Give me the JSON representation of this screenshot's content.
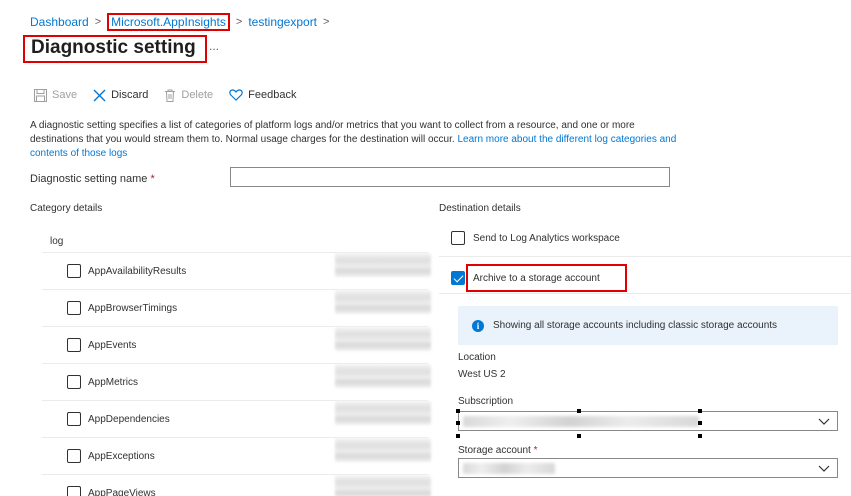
{
  "breadcrumb": {
    "items": [
      "Dashboard",
      "Microsoft.AppInsights",
      "testingexport"
    ],
    "separator": ">"
  },
  "header": {
    "title": "Diagnostic setting",
    "more": "..."
  },
  "toolbar": {
    "save_label": "Save",
    "discard_label": "Discard",
    "delete_label": "Delete",
    "feedback_label": "Feedback"
  },
  "description": {
    "text": "A diagnostic setting specifies a list of categories of platform logs and/or metrics that you want to collect from a resource, and one or more destinations that you would stream them to. Normal usage charges for the destination will occur.",
    "link": "Learn more about the different log categories and contents of those logs"
  },
  "name_field": {
    "label": "Diagnostic setting name",
    "required_mark": "*",
    "value": ""
  },
  "category_details": {
    "header": "Category details",
    "group_label": "log",
    "items": [
      {
        "label": "AppAvailabilityResults",
        "checked": false
      },
      {
        "label": "AppBrowserTimings",
        "checked": false
      },
      {
        "label": "AppEvents",
        "checked": false
      },
      {
        "label": "AppMetrics",
        "checked": false
      },
      {
        "label": "AppDependencies",
        "checked": false
      },
      {
        "label": "AppExceptions",
        "checked": false
      },
      {
        "label": "AppPageViews",
        "checked": false
      }
    ]
  },
  "destination_details": {
    "header": "Destination details",
    "log_analytics_label": "Send to Log Analytics workspace",
    "log_analytics_checked": false,
    "archive_label": "Archive to a storage account",
    "archive_checked": true,
    "info_text": "Showing all storage accounts including classic storage accounts",
    "location_label": "Location",
    "location_value": "West US 2",
    "subscription_label": "Subscription",
    "storage_label": "Storage account",
    "storage_required_mark": "*"
  },
  "colors": {
    "accent": "#0078d4",
    "highlight_border": "#e00000",
    "info_background": "#eaf3fb",
    "required": "#a4262c"
  }
}
